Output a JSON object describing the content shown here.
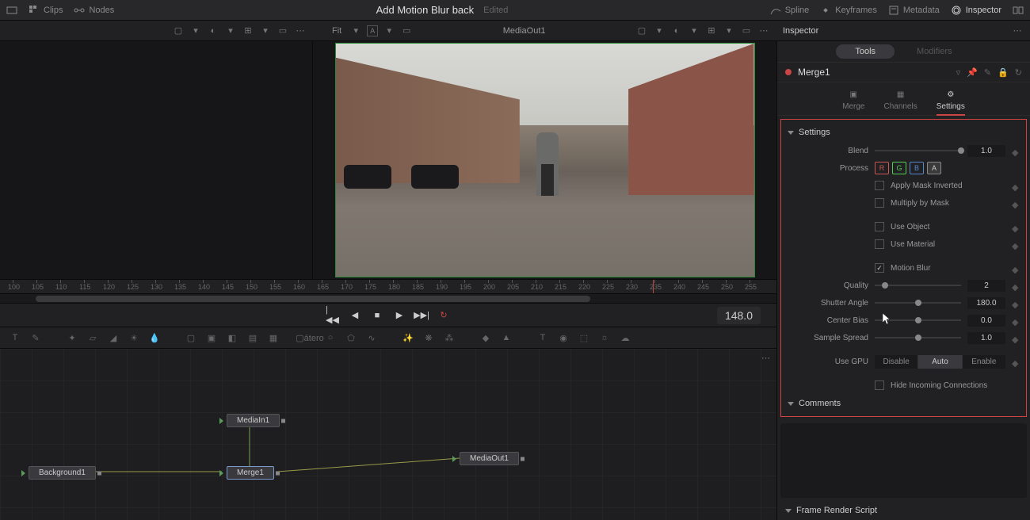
{
  "header": {
    "clips": "Clips",
    "nodes": "Nodes",
    "title": "Add Motion Blur back",
    "subtitle": "Edited",
    "spline": "Spline",
    "keyframes": "Keyframes",
    "metadata": "Metadata",
    "inspector": "Inspector"
  },
  "toolbar": {
    "fit": "Fit",
    "media_out": "MediaOut1",
    "inspector_label": "Inspector"
  },
  "ruler": {
    "ticks": [
      "100",
      "105",
      "110",
      "115",
      "120",
      "125",
      "130",
      "135",
      "140",
      "145",
      "150",
      "155",
      "160",
      "165",
      "170",
      "175",
      "180",
      "185",
      "190",
      "195",
      "200",
      "205",
      "210",
      "215",
      "220",
      "225",
      "230",
      "235",
      "240",
      "245",
      "250",
      "255"
    ]
  },
  "transport": {
    "frame": "148.0"
  },
  "nodes": {
    "background": "Background1",
    "mediain": "MediaIn1",
    "merge": "Merge1",
    "mediaout": "MediaOut1"
  },
  "inspector": {
    "tabs": {
      "tools": "Tools",
      "modifiers": "Modifiers"
    },
    "node_name": "Merge1",
    "sub_tabs": {
      "merge": "Merge",
      "channels": "Channels",
      "settings": "Settings"
    },
    "sections": {
      "settings": "Settings",
      "comments": "Comments",
      "frame_render": "Frame Render Script"
    },
    "props": {
      "blend": {
        "label": "Blend",
        "value": "1.0"
      },
      "process": {
        "label": "Process",
        "r": "R",
        "g": "G",
        "b": "B",
        "a": "A"
      },
      "apply_mask": "Apply Mask Inverted",
      "multiply_mask": "Multiply by Mask",
      "use_object": "Use Object",
      "use_material": "Use Material",
      "motion_blur": "Motion Blur",
      "quality": {
        "label": "Quality",
        "value": "2"
      },
      "shutter": {
        "label": "Shutter Angle",
        "value": "180.0"
      },
      "center_bias": {
        "label": "Center Bias",
        "value": "0.0"
      },
      "sample_spread": {
        "label": "Sample Spread",
        "value": "1.0"
      },
      "use_gpu": {
        "label": "Use GPU",
        "disable": "Disable",
        "auto": "Auto",
        "enable": "Enable"
      },
      "hide_conn": "Hide Incoming Connections"
    }
  }
}
